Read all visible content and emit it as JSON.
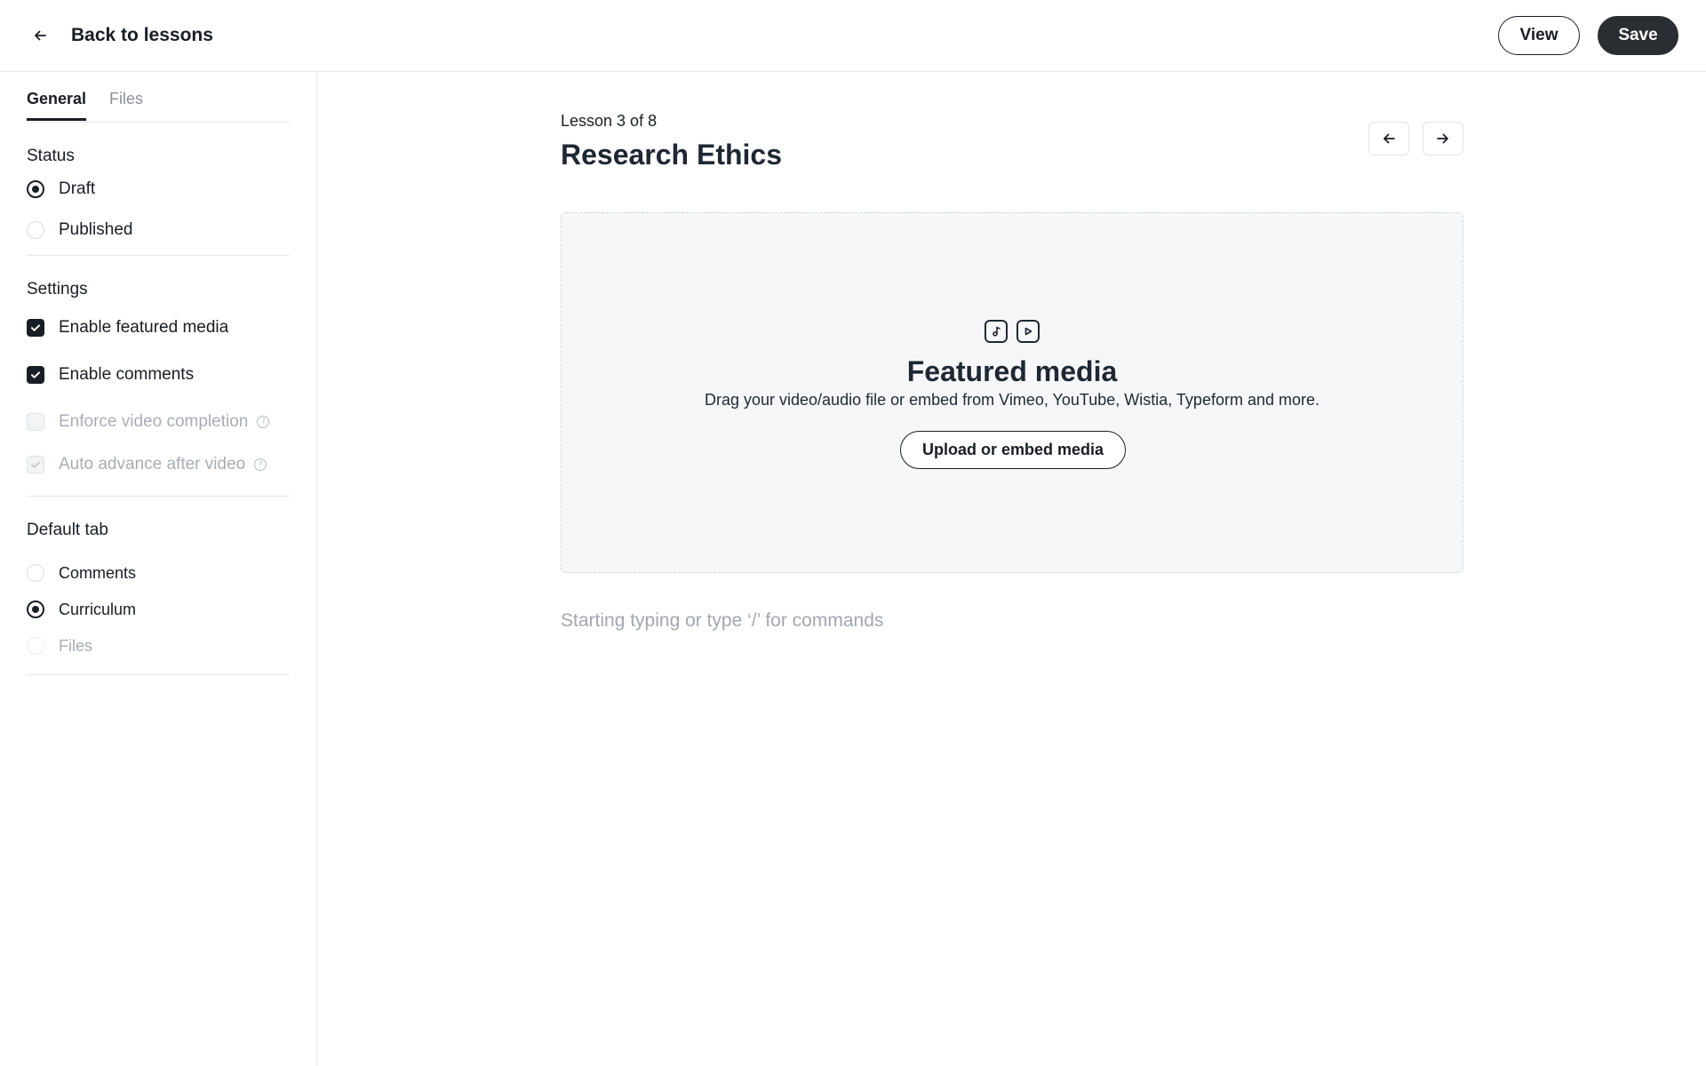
{
  "header": {
    "back_label": "Back to lessons",
    "view_label": "View",
    "save_label": "Save"
  },
  "sidebar": {
    "tabs": [
      {
        "label": "General",
        "active": true
      },
      {
        "label": "Files",
        "active": false
      }
    ],
    "status": {
      "title": "Status",
      "options": [
        {
          "label": "Draft",
          "selected": true
        },
        {
          "label": "Published",
          "selected": false
        }
      ]
    },
    "settings": {
      "title": "Settings",
      "items": [
        {
          "label": "Enable featured media",
          "checked": true,
          "disabled": false
        },
        {
          "label": "Enable comments",
          "checked": true,
          "disabled": false
        },
        {
          "label": "Enforce video completion",
          "checked": false,
          "disabled": true,
          "help": "?"
        },
        {
          "label": "Auto advance after video",
          "checked": true,
          "disabled": true,
          "help": "?"
        }
      ]
    },
    "default_tab": {
      "title": "Default tab",
      "options": [
        {
          "label": "Comments",
          "selected": false,
          "disabled": false
        },
        {
          "label": "Curriculum",
          "selected": true,
          "disabled": false
        },
        {
          "label": "Files",
          "selected": false,
          "disabled": true
        }
      ]
    }
  },
  "main": {
    "lesson_count": "Lesson 3 of 8",
    "lesson_title": "Research Ethics",
    "featured_media": {
      "title": "Featured media",
      "description": "Drag your video/audio file or embed from Vimeo, YouTube, Wistia, Typeform and more.",
      "button_label": "Upload or embed media"
    },
    "editor_placeholder": "Starting typing or type ‘/’ for commands"
  },
  "colors": {
    "primary": "#191d24",
    "title": "#1f2733",
    "border": "#e5e7eb",
    "muted": "#a2a7ae",
    "dropzone_bg": "#f6f7f8"
  }
}
